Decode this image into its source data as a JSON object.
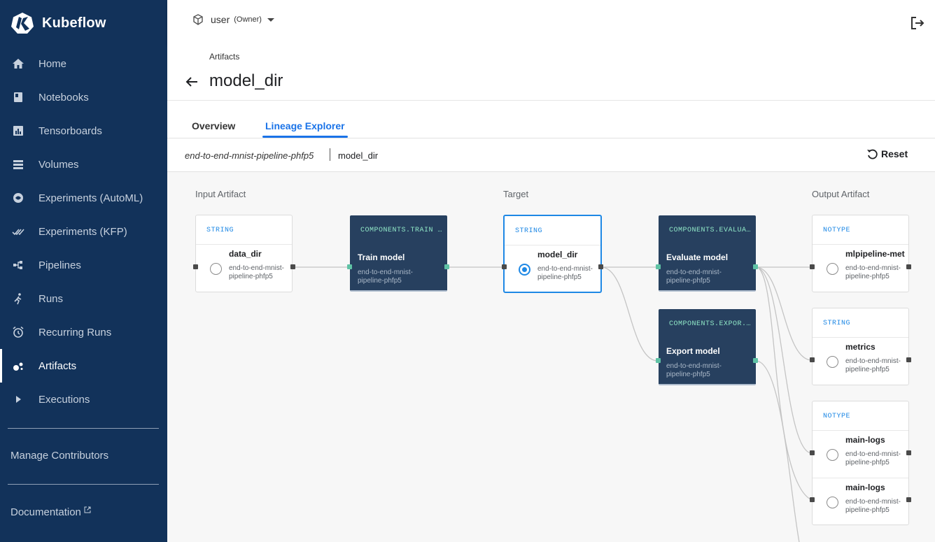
{
  "app": {
    "name": "Kubeflow"
  },
  "sidebar": {
    "items": [
      {
        "label": "Home",
        "icon": "home-icon"
      },
      {
        "label": "Notebooks",
        "icon": "notebook-icon"
      },
      {
        "label": "Tensorboards",
        "icon": "chart-icon"
      },
      {
        "label": "Volumes",
        "icon": "storage-icon"
      },
      {
        "label": "Experiments (AutoML)",
        "icon": "automl-icon"
      },
      {
        "label": "Experiments (KFP)",
        "icon": "check-done-icon"
      },
      {
        "label": "Pipelines",
        "icon": "pipelines-icon"
      },
      {
        "label": "Runs",
        "icon": "run-icon"
      },
      {
        "label": "Recurring Runs",
        "icon": "alarm-icon"
      },
      {
        "label": "Artifacts",
        "icon": "bubbles-icon",
        "active": true
      },
      {
        "label": "Executions",
        "icon": "play-icon"
      }
    ],
    "manage": "Manage Contributors",
    "docs": "Documentation"
  },
  "topbar": {
    "namespace_user": "user",
    "namespace_role": "(Owner)"
  },
  "header": {
    "breadcrumb": "Artifacts",
    "title": "model_dir"
  },
  "tabs": {
    "overview": "Overview",
    "lineage": "Lineage Explorer"
  },
  "lineage_toolbar": {
    "run": "end-to-end-mnist-pipeline-phfp5",
    "artifact": "model_dir",
    "reset": "Reset"
  },
  "graph": {
    "columns": {
      "input": "Input Artifact",
      "target": "Target",
      "output": "Output Artifact"
    },
    "input_artifact": {
      "type": "STRING",
      "name": "data_dir",
      "sub": "end-to-end-mnist-pipeline-phfp5"
    },
    "train_exec": {
      "type": "COMPONENTS.TRAIN ...",
      "name": "Train model",
      "sub": "end-to-end-mnist-pipeline-phfp5"
    },
    "target_artifact": {
      "type": "STRING",
      "name": "model_dir",
      "sub": "end-to-end-mnist-pipeline-phfp5"
    },
    "evaluate_exec": {
      "type": "COMPONENTS.EVALUA...",
      "name": "Evaluate model",
      "sub": "end-to-end-mnist-pipeline-phfp5"
    },
    "export_exec": {
      "type": "COMPONENTS.EXPOR...",
      "name": "Export model",
      "sub": "end-to-end-mnist-pipeline-phfp5"
    },
    "out_metadata": {
      "type": "NOTYPE",
      "name": "mlpipeline-met",
      "sub": "end-to-end-mnist-pipeline-phfp5"
    },
    "out_metrics": {
      "type": "STRING",
      "name": "metrics",
      "sub": "end-to-end-mnist-pipeline-phfp5"
    },
    "out_logs": {
      "type": "NOTYPE",
      "rows": [
        {
          "name": "main-logs",
          "sub": "end-to-end-mnist-pipeline-phfp5"
        },
        {
          "name": "main-logs",
          "sub": "end-to-end-mnist-pipeline-phfp5"
        }
      ]
    }
  },
  "colors": {
    "sidebar": "#12325a",
    "accent": "#1e88e5",
    "exec_node": "#27405f",
    "exec_type": "#8fe6c6"
  }
}
